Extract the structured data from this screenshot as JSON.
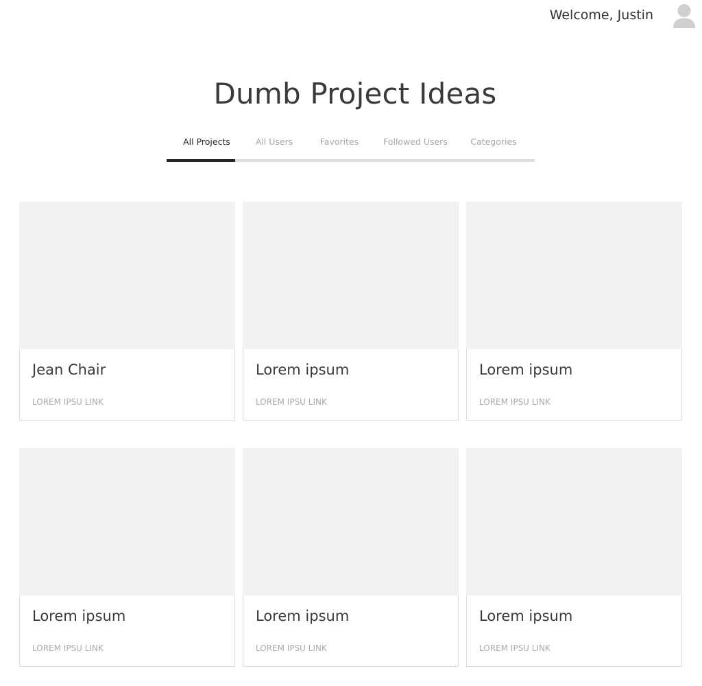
{
  "header": {
    "welcome_text": "Welcome, Justin",
    "avatar_icon": "user-avatar-icon"
  },
  "page": {
    "title": "Dumb Project Ideas"
  },
  "tabs": [
    {
      "label": "All Projects",
      "active": true
    },
    {
      "label": "All Users",
      "active": false
    },
    {
      "label": "Favorites",
      "active": false
    },
    {
      "label": "Followed Users",
      "active": false
    },
    {
      "label": "Categories",
      "active": false
    }
  ],
  "cards": [
    {
      "title": "Jean Chair",
      "link": "LOREM IPSU LINK"
    },
    {
      "title": "Lorem ipsum",
      "link": "LOREM IPSU LINK"
    },
    {
      "title": "Lorem ipsum",
      "link": "LOREM IPSU LINK"
    },
    {
      "title": "Lorem ipsum",
      "link": "LOREM IPSU LINK"
    },
    {
      "title": "Lorem ipsum",
      "link": "LOREM IPSU LINK"
    },
    {
      "title": "Lorem ipsum",
      "link": "LOREM IPSU LINK"
    }
  ],
  "colors": {
    "text": "#3a3a3a",
    "tab_active": "#262626",
    "tab_inactive": "#a6a6a6",
    "tab_track": "#dedede",
    "image_placeholder": "#f2f2f2",
    "card_border": "#dcdcdc",
    "link": "#aaaaaa"
  }
}
